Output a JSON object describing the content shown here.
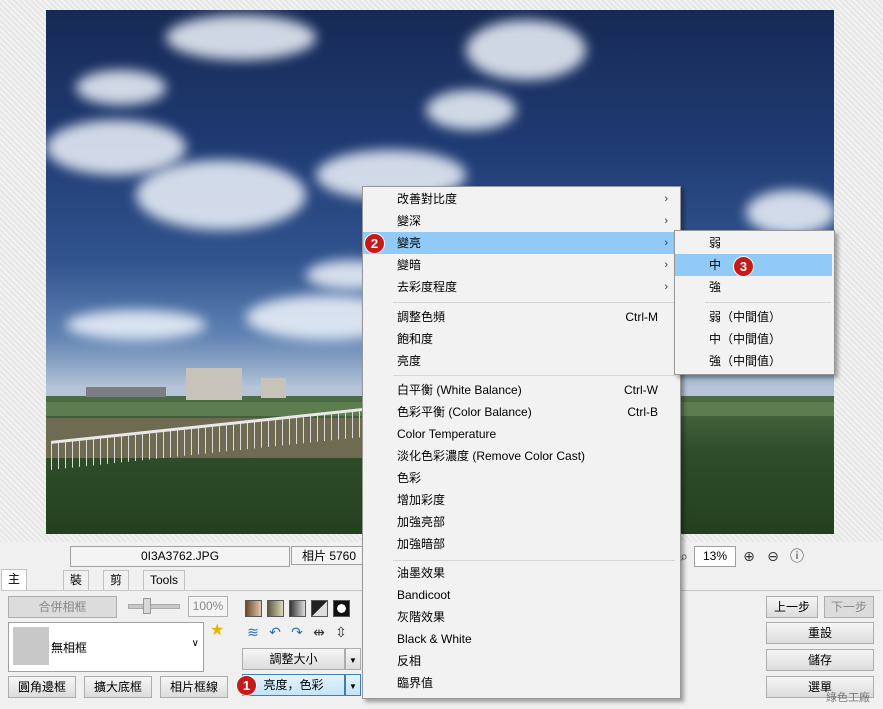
{
  "status": {
    "filename": "0I3A3762.JPG",
    "photo_info": "相片 5760",
    "zoom": "13%"
  },
  "tabs": [
    "主要功能",
    "裝飾",
    "剪裁",
    "Tools"
  ],
  "left_panel": {
    "merge_frame": "合併相框",
    "opacity": "100%",
    "frame_name": "無相框",
    "round_border": "圓角邊框",
    "expand_base": "擴大底框",
    "photo_frame_line": "相片框線"
  },
  "mid_panel": {
    "resize": "調整大小",
    "brightness_color": "亮度，色彩"
  },
  "right_panel": {
    "undo": "上一步",
    "redo": "下一步",
    "reset": "重設",
    "save": "儲存",
    "select": "選單"
  },
  "menu": {
    "group1": [
      {
        "label": "改善對比度",
        "arrow": "›"
      },
      {
        "label": "變深",
        "arrow": "›"
      },
      {
        "label": "變亮",
        "arrow": "›"
      },
      {
        "label": "變暗",
        "arrow": "›"
      },
      {
        "label": "去彩度程度",
        "arrow": "›"
      }
    ],
    "group2": [
      {
        "label": "調整色頻",
        "shortcut": "Ctrl-M"
      },
      {
        "label": "飽和度",
        "shortcut": ""
      },
      {
        "label": "亮度",
        "shortcut": ""
      }
    ],
    "group3": [
      {
        "label": "白平衡 (White Balance)",
        "shortcut": "Ctrl-W"
      },
      {
        "label": "色彩平衡 (Color Balance)",
        "shortcut": "Ctrl-B"
      },
      {
        "label": "Color Temperature",
        "shortcut": ""
      },
      {
        "label": "淡化色彩濃度 (Remove Color Cast)",
        "shortcut": ""
      },
      {
        "label": "色彩",
        "shortcut": ""
      },
      {
        "label": "增加彩度",
        "shortcut": ""
      },
      {
        "label": "加強亮部",
        "shortcut": ""
      },
      {
        "label": "加強暗部",
        "shortcut": ""
      }
    ],
    "group4": [
      "油墨效果",
      "Bandicoot",
      "灰階效果",
      "Black & White",
      "反相",
      "臨界值"
    ]
  },
  "submenu": {
    "group1": [
      "弱",
      "中",
      "強"
    ],
    "group2": [
      "弱（中間值）",
      "中（中間值）",
      "強（中間值）"
    ]
  },
  "badges": [
    "2",
    "3",
    "1"
  ],
  "watermark": "綠色工廠",
  "colors": {
    "highlight": "#91c9f7",
    "badge": "#c41a1a"
  }
}
